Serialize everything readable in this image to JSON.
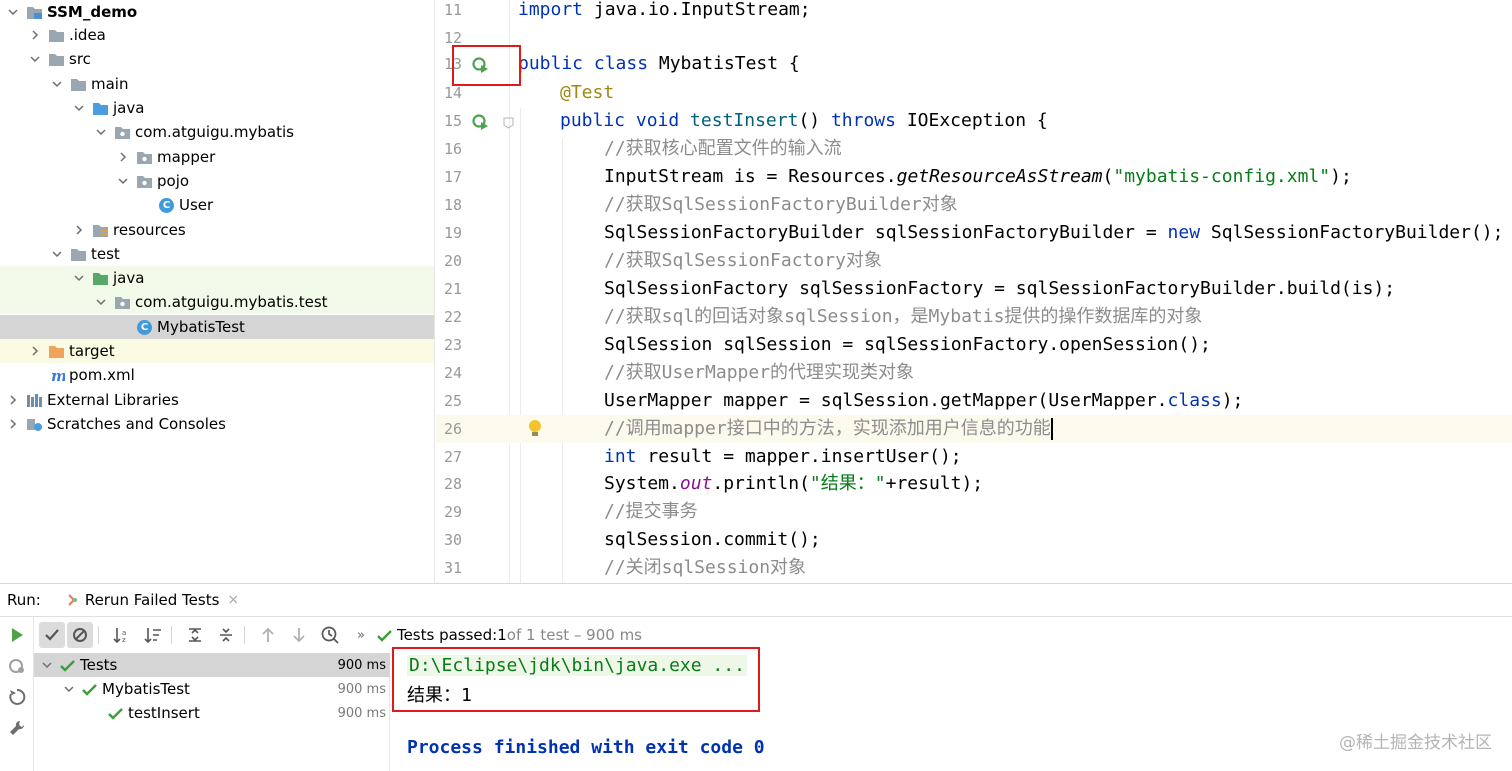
{
  "project_tree": {
    "items": [
      {
        "label": "SSM_demo",
        "icon": "module-folder-icon",
        "bold": true
      },
      {
        "label": ".idea",
        "icon": "folder-icon"
      },
      {
        "label": "src",
        "icon": "folder-icon"
      },
      {
        "label": "main",
        "icon": "folder-icon"
      },
      {
        "label": "java",
        "icon": "source-root-folder-icon"
      },
      {
        "label": "com.atguigu.mybatis",
        "icon": "package-icon"
      },
      {
        "label": "mapper",
        "icon": "package-icon"
      },
      {
        "label": "pojo",
        "icon": "package-icon"
      },
      {
        "label": "User",
        "icon": "class-icon"
      },
      {
        "label": "resources",
        "icon": "resources-folder-icon"
      },
      {
        "label": "test",
        "icon": "folder-icon"
      },
      {
        "label": "java",
        "icon": "test-root-folder-icon"
      },
      {
        "label": "com.atguigu.mybatis.test",
        "icon": "package-icon"
      },
      {
        "label": "MybatisTest",
        "icon": "test-class-icon"
      },
      {
        "label": "target",
        "icon": "excluded-folder-icon"
      },
      {
        "label": "pom.xml",
        "icon": "maven-icon"
      },
      {
        "label": "External Libraries",
        "icon": "libraries-icon"
      },
      {
        "label": "Scratches and Consoles",
        "icon": "scratches-icon"
      }
    ],
    "class_icon_letter": "C"
  },
  "editor": {
    "line_numbers": [
      "11",
      "12",
      "13",
      "14",
      "15",
      "16",
      "17",
      "18",
      "19",
      "20",
      "21",
      "22",
      "23",
      "24",
      "25",
      "26",
      "27",
      "28",
      "29",
      "30",
      "31"
    ],
    "code": {
      "l11_kw": "import",
      "l11_rest": " java.io.InputStream;",
      "l13_kw": "public class",
      "l13_rest": " MybatisTest {",
      "l14_ann": "@Test",
      "l15_kw1": "public void",
      "l15_mtd": " testInsert",
      "l15_mid": "() ",
      "l15_kw2": "throws",
      "l15_rest": " IOException {",
      "l16_cmt": "//获取核心配置文件的输入流",
      "l17_a": "InputStream is = Resources.",
      "l17_it": "getResourceAsStream",
      "l17_b": "(",
      "l17_str": "\"mybatis-config.xml\"",
      "l17_c": ");",
      "l18_cmt": "//获取SqlSessionFactoryBuilder对象",
      "l19_a": "SqlSessionFactoryBuilder sqlSessionFactoryBuilder = ",
      "l19_kw": "new",
      "l19_b": " SqlSessionFactoryBuilder();",
      "l20_cmt": "//获取SqlSessionFactory对象",
      "l21": "SqlSessionFactory sqlSessionFactory = sqlSessionFactoryBuilder.build(is);",
      "l22_cmt": "//获取sql的回话对象sqlSession，是Mybatis提供的操作数据库的对象",
      "l23": "SqlSession sqlSession = sqlSessionFactory.openSession();",
      "l24_cmt": "//获取UserMapper的代理实现类对象",
      "l25_a": "UserMapper mapper = sqlSession.getMapper(UserMapper.",
      "l25_kw": "class",
      "l25_b": ");",
      "l26_cmt": "//调用mapper接口中的方法，实现添加用户信息的功能",
      "l27_kw": "int",
      "l27_rest": " result = mapper.insertUser();",
      "l28_a": "System.",
      "l28_stat": "out",
      "l28_b": ".println(",
      "l28_str": "\"结果：\"",
      "l28_c": "+result);",
      "l29_cmt": "//提交事务",
      "l30": "sqlSession.commit();",
      "l31_cmt": "//关闭sqlSession对象"
    }
  },
  "run_panel": {
    "label": "Run:",
    "tab_label": "Rerun Failed Tests",
    "tab_close": "×",
    "more": "»",
    "summary": {
      "prefix": "Tests passed: ",
      "count": "1",
      "suffix": " of 1 test – 900 ms"
    },
    "tests": [
      {
        "label": "Tests",
        "time": "900 ms"
      },
      {
        "label": "MybatisTest",
        "time": "900 ms"
      },
      {
        "label": "testInsert",
        "time": "900 ms"
      }
    ],
    "console": {
      "command": "D:\\Eclipse\\jdk\\bin\\java.exe ...",
      "result": "结果：1",
      "exit": "Process finished with exit code 0"
    }
  },
  "watermark": "@稀土掘金技术社区",
  "colors": {
    "highlight_box": "#e01a1a",
    "pass_green": "#3b9e3b",
    "keyword": "#0033b3",
    "string": "#067d17",
    "comment": "#8c8c8c"
  }
}
